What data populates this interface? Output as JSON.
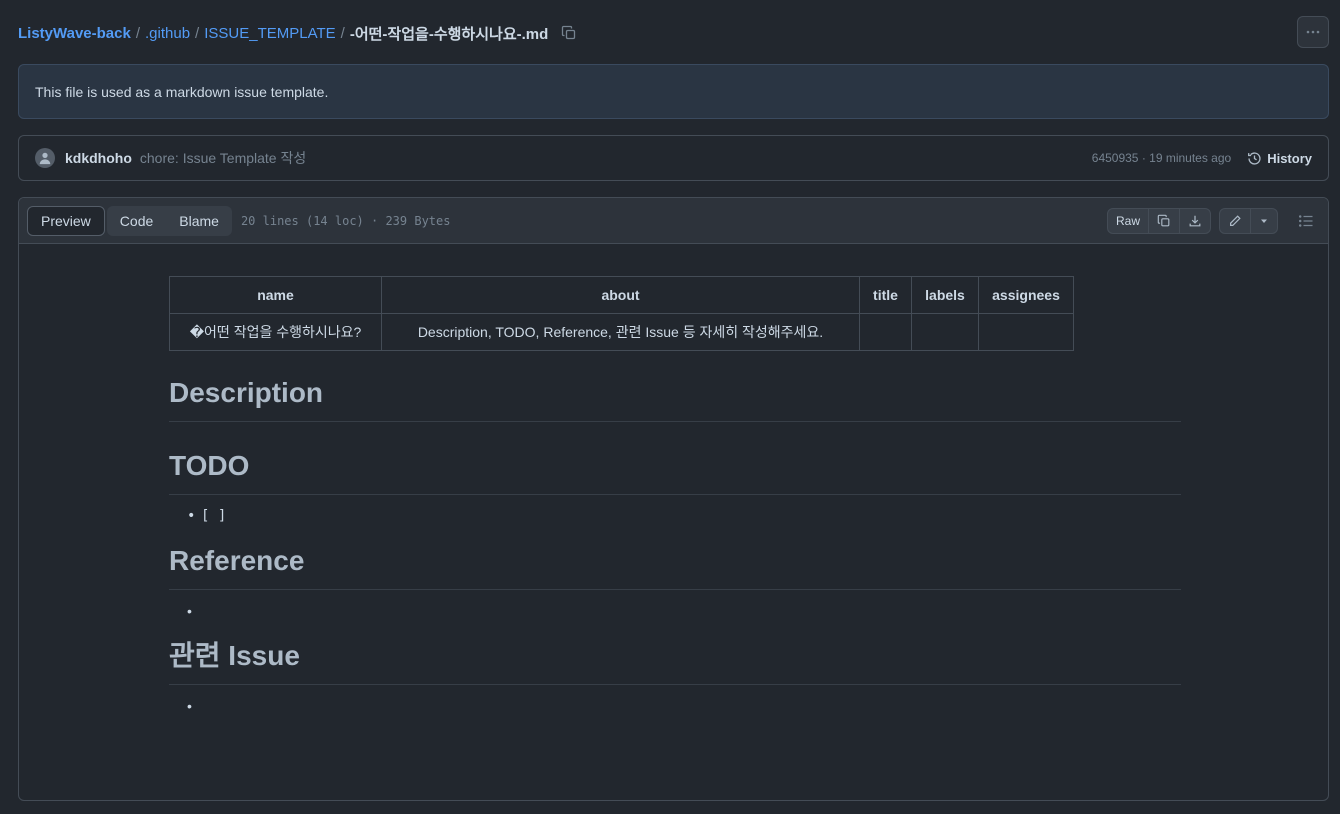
{
  "breadcrumb": {
    "repo": "ListyWave-back",
    "dir1": ".github",
    "dir2": "ISSUE_TEMPLATE",
    "file": "-어떤-작업을-수행하시나요-.md",
    "separator": "/"
  },
  "more_button_icon": "kebab-horizontal-icon",
  "notice": {
    "text": "This file is used as a markdown issue template."
  },
  "commit": {
    "author": "kdkdhoho",
    "message": "chore: Issue Template 작성",
    "sha_time": "6450935 · 19 minutes ago",
    "history_label": "History"
  },
  "file_header": {
    "tabs": {
      "preview": "Preview",
      "code": "Code",
      "blame": "Blame"
    },
    "info": "20 lines (14 loc) · 239 Bytes",
    "raw_label": "Raw"
  },
  "markdown": {
    "table": {
      "headers": [
        "name",
        "about",
        "title",
        "labels",
        "assignees"
      ],
      "row": [
        "�어떤 작업을 수행하시나요?",
        "Description, TODO, Reference, 관련 Issue 등 자세히 작성해주세요.",
        "",
        "",
        ""
      ]
    },
    "sections": {
      "description": {
        "heading": "Description"
      },
      "todo": {
        "heading": "TODO",
        "item": "[ ]"
      },
      "reference": {
        "heading": "Reference",
        "item": ""
      },
      "issue": {
        "heading": "관련 Issue",
        "item": ""
      }
    }
  },
  "colors": {
    "accent": "#539bf5",
    "background": "#22272e",
    "border": "#444c56"
  }
}
